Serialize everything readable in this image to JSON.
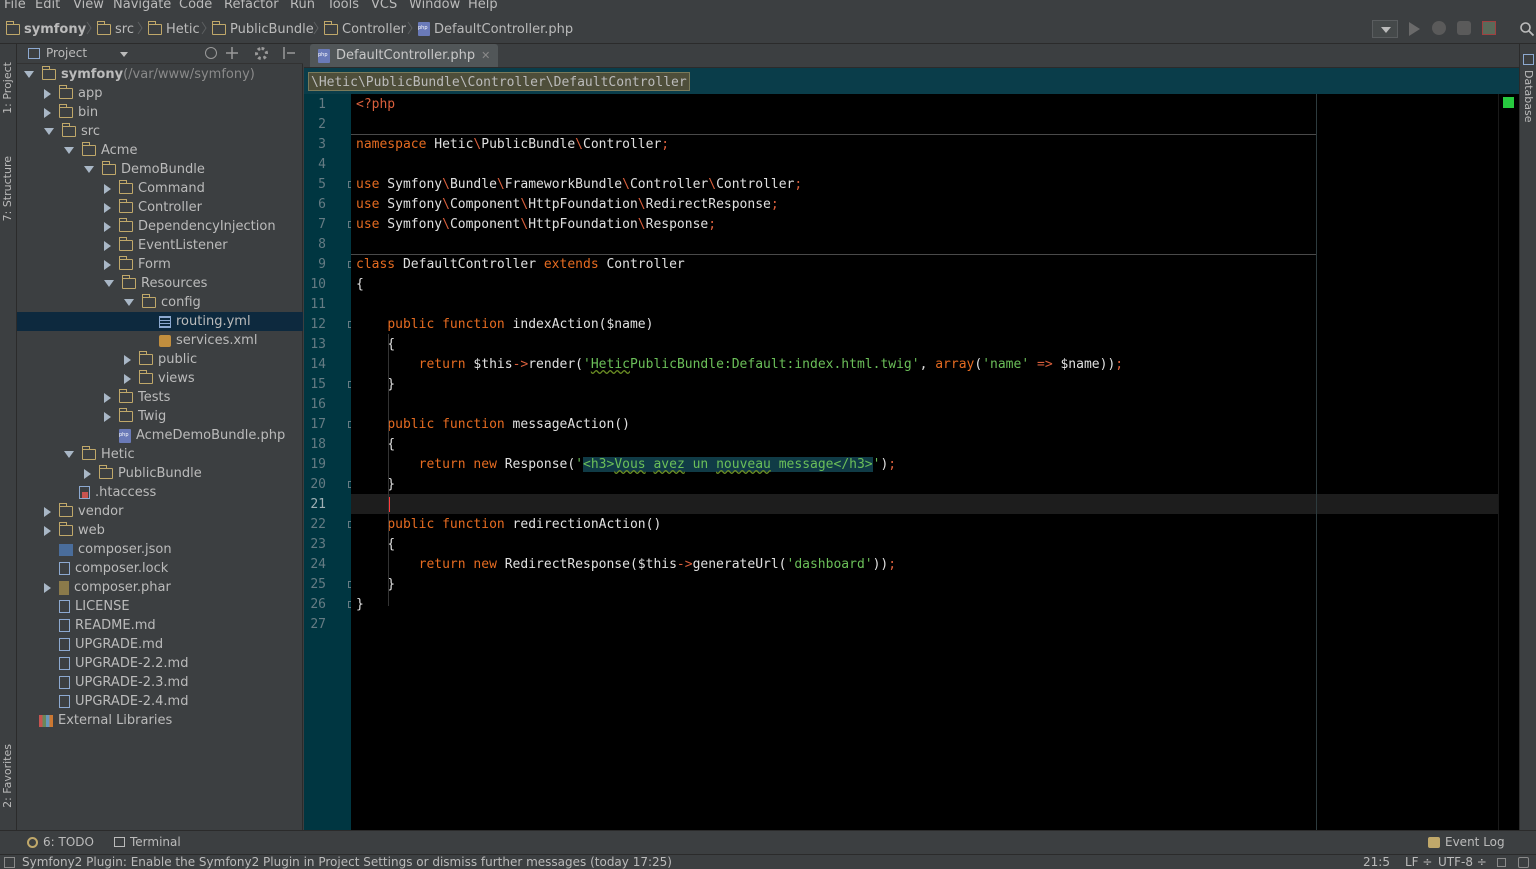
{
  "menu": [
    "File",
    "Edit",
    "View",
    "Navigate",
    "Code",
    "Refactor",
    "Run",
    "Tools",
    "VCS",
    "Window",
    "Help"
  ],
  "breadcrumbs": [
    {
      "label": "symfony",
      "icon": "folder-icon",
      "bold": true
    },
    {
      "label": "src",
      "icon": "folder-icon"
    },
    {
      "label": "Hetic",
      "icon": "folder-icon"
    },
    {
      "label": "PublicBundle",
      "icon": "folder-icon"
    },
    {
      "label": "Controller",
      "icon": "folder-icon"
    },
    {
      "label": "DefaultController.php",
      "icon": "php-file-icon"
    }
  ],
  "left_strip": {
    "project_tab": "1: Project",
    "structure_tab": "7: Structure",
    "favorites_tab": "2: Favorites"
  },
  "right_strip": {
    "database_tab": "Database"
  },
  "project_panel": {
    "title": "Project",
    "tree": [
      {
        "label": "symfony",
        "extra": " (/var/www/symfony)",
        "arrow": "down",
        "icon": "folder",
        "bold": true
      },
      {
        "label": "app",
        "arrow": "right",
        "icon": "folder"
      },
      {
        "label": "bin",
        "arrow": "right",
        "icon": "folder"
      },
      {
        "label": "src",
        "arrow": "down",
        "icon": "folder"
      },
      {
        "label": "Acme",
        "arrow": "down",
        "icon": "folder"
      },
      {
        "label": "DemoBundle",
        "arrow": "down",
        "icon": "folder"
      },
      {
        "label": "Command",
        "arrow": "right",
        "icon": "folder"
      },
      {
        "label": "Controller",
        "arrow": "right",
        "icon": "folder"
      },
      {
        "label": "DependencyInjection",
        "arrow": "right",
        "icon": "folder"
      },
      {
        "label": "EventListener",
        "arrow": "right",
        "icon": "folder"
      },
      {
        "label": "Form",
        "arrow": "right",
        "icon": "folder"
      },
      {
        "label": "Resources",
        "arrow": "down",
        "icon": "folder"
      },
      {
        "label": "config",
        "arrow": "down",
        "icon": "folder"
      },
      {
        "label": "routing.yml",
        "arrow": "",
        "icon": "yml",
        "selected": true
      },
      {
        "label": "services.xml",
        "arrow": "",
        "icon": "xml"
      },
      {
        "label": "public",
        "arrow": "right",
        "icon": "folder"
      },
      {
        "label": "views",
        "arrow": "right",
        "icon": "folder"
      },
      {
        "label": "Tests",
        "arrow": "right",
        "icon": "folder"
      },
      {
        "label": "Twig",
        "arrow": "right",
        "icon": "folder"
      },
      {
        "label": "AcmeDemoBundle.php",
        "arrow": "",
        "icon": "php"
      },
      {
        "label": "Hetic",
        "arrow": "down",
        "icon": "folder"
      },
      {
        "label": "PublicBundle",
        "arrow": "right",
        "icon": "folder"
      },
      {
        "label": ".htaccess",
        "arrow": "",
        "icon": "htaccess"
      },
      {
        "label": "vendor",
        "arrow": "right",
        "icon": "folder"
      },
      {
        "label": "web",
        "arrow": "right",
        "icon": "folder"
      },
      {
        "label": "composer.json",
        "arrow": "",
        "icon": "json"
      },
      {
        "label": "composer.lock",
        "arrow": "",
        "icon": "file"
      },
      {
        "label": "composer.phar",
        "arrow": "right",
        "icon": "phar"
      },
      {
        "label": "LICENSE",
        "arrow": "",
        "icon": "file"
      },
      {
        "label": "README.md",
        "arrow": "",
        "icon": "file"
      },
      {
        "label": "UPGRADE.md",
        "arrow": "",
        "icon": "file"
      },
      {
        "label": "UPGRADE-2.2.md",
        "arrow": "",
        "icon": "file"
      },
      {
        "label": "UPGRADE-2.3.md",
        "arrow": "",
        "icon": "file"
      },
      {
        "label": "UPGRADE-2.4.md",
        "arrow": "",
        "icon": "file"
      },
      {
        "label": "External Libraries",
        "arrow": "",
        "icon": "library"
      }
    ]
  },
  "editor": {
    "tab_label": "DefaultController.php",
    "namespace_crumb": "\\Hetic\\PublicBundle\\Controller\\DefaultController",
    "cursor_line": 21,
    "lines": [
      "<?php",
      "",
      "namespace Hetic\\PublicBundle\\Controller;",
      "",
      "use Symfony\\Bundle\\FrameworkBundle\\Controller\\Controller;",
      "use Symfony\\Component\\HttpFoundation\\RedirectResponse;",
      "use Symfony\\Component\\HttpFoundation\\Response;",
      "",
      "class DefaultController extends Controller",
      "{",
      "",
      "    public function indexAction($name)",
      "    {",
      "        return $this->render('HeticPublicBundle:Default:index.html.twig', array('name' => $name));",
      "    }",
      "",
      "    public function messageAction()",
      "    {",
      "        return new Response('<h3>Vous avez un nouveau message</h3>');",
      "    }",
      "",
      "    public function redirectionAction()",
      "    {",
      "        return new RedirectResponse($this->generateUrl('dashboard'));",
      "    }",
      "}",
      ""
    ]
  },
  "bottom_bar": {
    "todo": "6: TODO",
    "terminal": "Terminal",
    "event_log": "Event Log"
  },
  "status_bar": {
    "message": "Symfony2 Plugin: Enable the Symfony2 Plugin in Project Settings or dismiss further messages (today 17:25)",
    "position": "21:5",
    "line_sep": "LF ÷",
    "encoding": "UTF-8 ÷"
  },
  "colors": {
    "keyword": "#e56b21",
    "string": "#6bbf59",
    "gutter": "#003641",
    "editor_bg": "#000000",
    "caret": "#ff3b3b"
  }
}
